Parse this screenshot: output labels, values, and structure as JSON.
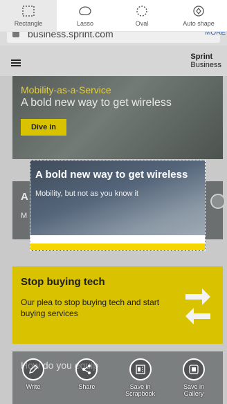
{
  "shape_bar": {
    "options": [
      {
        "label": "Rectangle",
        "icon": "rectangle-select-icon",
        "active": true
      },
      {
        "label": "Lasso",
        "icon": "lasso-icon",
        "active": false
      },
      {
        "label": "Oval",
        "icon": "oval-select-icon",
        "active": false
      },
      {
        "label": "Auto shape",
        "icon": "auto-shape-icon",
        "active": false
      }
    ]
  },
  "browser": {
    "url": "business.sprint.com",
    "more": "MORE"
  },
  "page": {
    "brand_line1": "Sprint",
    "brand_line2": "Business",
    "hero": {
      "kicker": "Mobility-as-a-Service",
      "title": "A bold new way to get wireless",
      "button": "Dive in"
    },
    "side_card": {
      "title": "A",
      "subtitle": "M"
    },
    "promo": {
      "title": "Stop buying tech",
      "body": "Our plea to stop buying tech and start buying services"
    },
    "lower_card": {
      "text": "How do you equip"
    }
  },
  "snippet": {
    "title": "A bold new way to get wireless",
    "subtitle": "Mobility, but not as you know it"
  },
  "actions": [
    {
      "label": "Write",
      "icon": "write-icon"
    },
    {
      "label": "Share",
      "icon": "share-icon"
    },
    {
      "label": "Save in Scrapbook",
      "icon": "scrapbook-icon"
    },
    {
      "label": "Save in Gallery",
      "icon": "gallery-icon"
    }
  ],
  "colors": {
    "accent_yellow": "#d9c200",
    "snippet_yellow": "#f5d600"
  }
}
